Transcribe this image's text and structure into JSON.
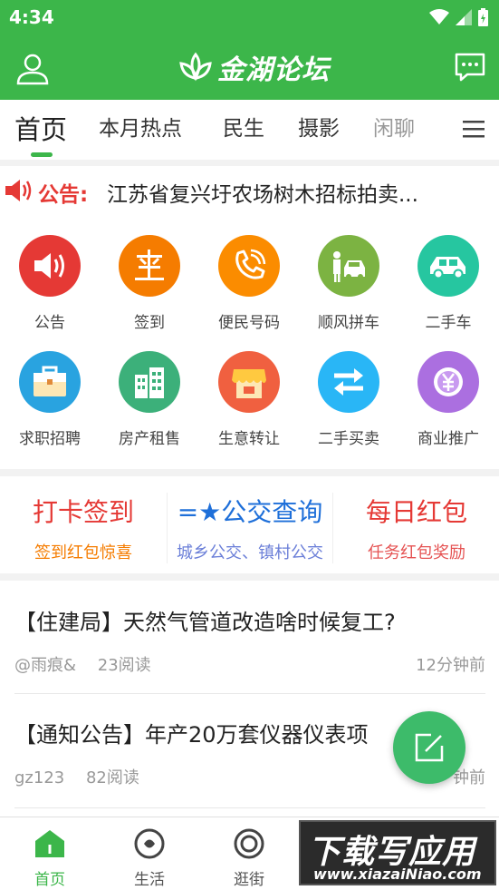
{
  "status_bar": {
    "time": "4:34"
  },
  "header": {
    "logo_text": "金湖论坛"
  },
  "tabs": [
    {
      "label": "首页",
      "active": true
    },
    {
      "label": "本月热点"
    },
    {
      "label": "民生"
    },
    {
      "label": "摄影"
    },
    {
      "label": "闲聊"
    }
  ],
  "notice": {
    "label": "公告:",
    "text": "江苏省复兴圩农场树木招标拍卖..."
  },
  "grid": [
    {
      "label": "公告",
      "icon": "speaker-icon",
      "color": "#e53935"
    },
    {
      "label": "签到",
      "icon": "sign-in-icon",
      "color": "#f57c00"
    },
    {
      "label": "便民号码",
      "icon": "phone-icon",
      "color": "#fb8c00"
    },
    {
      "label": "顺风拼车",
      "icon": "carpool-icon",
      "color": "#7cb342"
    },
    {
      "label": "二手车",
      "icon": "car-icon",
      "color": "#26c6a0"
    },
    {
      "label": "求职招聘",
      "icon": "briefcase-icon",
      "color": "#29a3e0"
    },
    {
      "label": "房产租售",
      "icon": "building-icon",
      "color": "#3cb07a"
    },
    {
      "label": "生意转让",
      "icon": "shop-icon",
      "color": "#f06040"
    },
    {
      "label": "二手买卖",
      "icon": "exchange-icon",
      "color": "#29b6f6"
    },
    {
      "label": "商业推广",
      "icon": "yen-icon",
      "color": "#ab6fe0"
    }
  ],
  "promo": [
    {
      "title": "打卡签到",
      "sub": "签到红包惊喜",
      "title_color": "#e53935",
      "sub_color": "#f57c00"
    },
    {
      "title": "=★公交查询",
      "sub": "城乡公交、镇村公交",
      "title_color": "#1e6fd9",
      "sub_color": "#6b7fd8"
    },
    {
      "title": "每日红包",
      "sub": "任务红包奖励",
      "title_color": "#e53935",
      "sub_color": "#e55353"
    }
  ],
  "posts": [
    {
      "title": "【住建局】天然气管道改造啥时候复工?",
      "author": "@雨痕&",
      "reads": "23阅读",
      "time": "12分钟前"
    },
    {
      "title": "【通知公告】年产20万套仪器仪表项",
      "author": "gz123",
      "reads": "82阅读",
      "time": "钟前"
    }
  ],
  "bottom_nav": [
    {
      "label": "首页",
      "active": true
    },
    {
      "label": "生活"
    },
    {
      "label": "逛街"
    }
  ],
  "watermark": {
    "big": "下载写应用",
    "small": "www.xiazaiNiao.com"
  }
}
